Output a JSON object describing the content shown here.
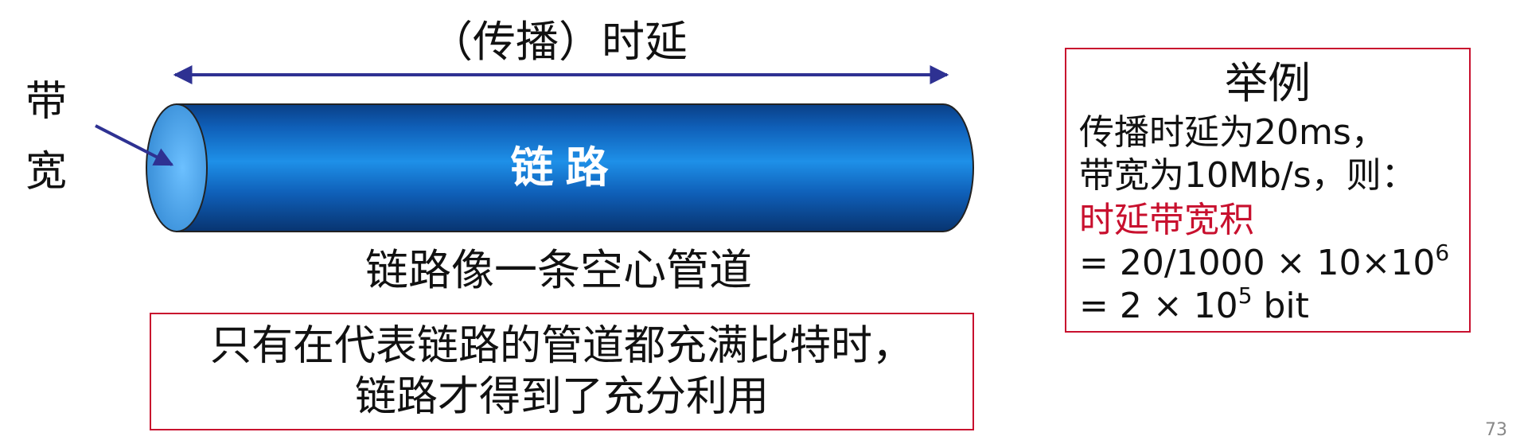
{
  "diagram": {
    "delay_label": "（传播）时延",
    "bandwidth_label_line1": "带",
    "bandwidth_label_line2": "宽",
    "pipe_label": "链 路",
    "pipe_caption": "链路像一条空心管道",
    "note_line1": "只有在代表链路的管道都充满比特时，",
    "note_line2": "链路才得到了充分利用"
  },
  "example": {
    "title": "举例",
    "line1": "传播时延为20ms，",
    "line2": "带宽为10Mb/s，则：",
    "line3": "时延带宽积",
    "line4_prefix": "= 20/1000  × 10×10",
    "line4_exp": "6",
    "line5_prefix": "= 2 × 10",
    "line5_exp": "5",
    "line5_suffix": " bit"
  },
  "page_number": "73",
  "colors": {
    "arrow": "#2e3192",
    "pipe_dark": "#0a3f86",
    "pipe_light": "#1e90e8",
    "pipe_end": "#5fb4ff",
    "box_border": "#c8102e",
    "highlight_text": "#c8102e"
  }
}
